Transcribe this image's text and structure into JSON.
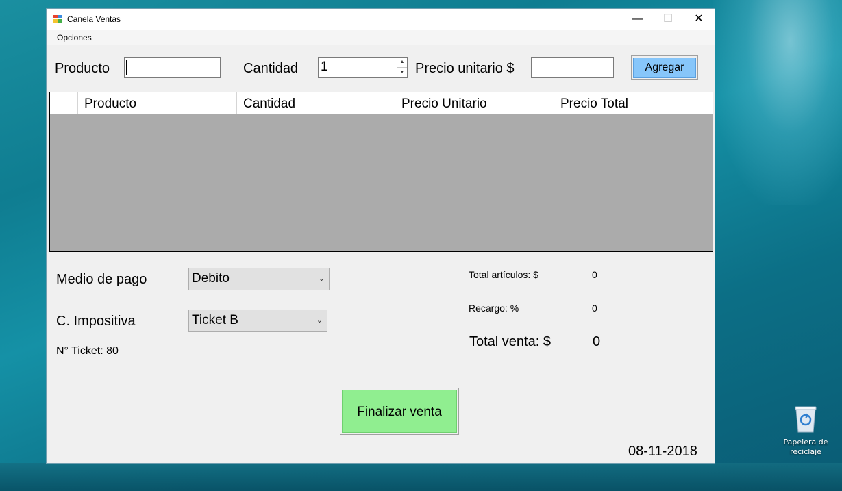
{
  "window": {
    "title": "Canela Ventas",
    "minimize_glyph": "—",
    "maximize_glyph": "☐",
    "close_glyph": "✕"
  },
  "menu": {
    "items": [
      {
        "label": "Opciones"
      }
    ]
  },
  "entry": {
    "producto_label": "Producto",
    "producto_value": "",
    "cantidad_label": "Cantidad",
    "cantidad_value": "1",
    "precio_label": "Precio unitario $",
    "precio_value": "",
    "add_button": "Agregar"
  },
  "grid": {
    "columns": [
      "Producto",
      "Cantidad",
      "Precio Unitario",
      "Precio Total"
    ],
    "rows": []
  },
  "payment": {
    "medio_label": "Medio de pago",
    "medio_value": "Debito",
    "impositiva_label": "C. Impositiva",
    "impositiva_value": "Ticket B",
    "ticket_label": "N° Ticket: 80"
  },
  "totals": {
    "articulos_label": "Total artículos: $",
    "articulos_value": "0",
    "recargo_label": "Recargo:  %",
    "recargo_value": "0",
    "venta_label": "Total venta: $",
    "venta_value": "0"
  },
  "finalize_button": "Finalizar venta",
  "date": "08-11-2018",
  "desktop": {
    "recycle_bin_label": "Papelera de reciclaje"
  },
  "colors": {
    "agregar_button": "#87c6fa",
    "finalizar_button": "#90ee90",
    "grid_background": "#ababab"
  }
}
